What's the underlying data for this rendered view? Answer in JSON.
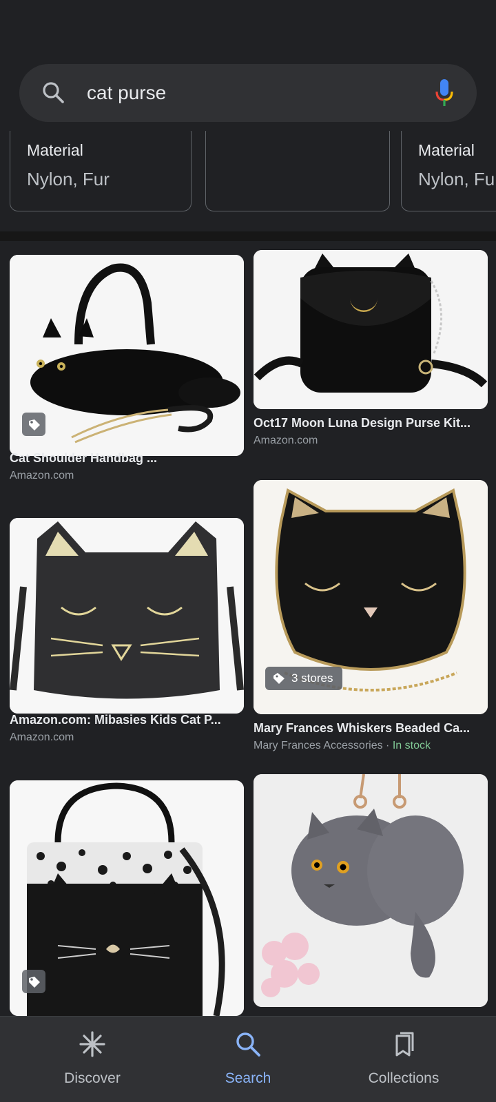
{
  "search": {
    "query": "cat purse",
    "search_icon": "search-icon",
    "mic_icon": "mic-icon"
  },
  "attribute_cards": [
    {
      "label": "Material",
      "value": "Nylon, Fur"
    },
    {
      "label": "",
      "value": ""
    },
    {
      "label": "Material",
      "value": "Nylon, Fu"
    }
  ],
  "results": [
    {
      "title": "Cat Shoulder Handbag ...",
      "source": "Amazon.com",
      "badge": "tag-icon"
    },
    {
      "title": "Oct17 Moon Luna Design Purse Kit...",
      "source": "Amazon.com"
    },
    {
      "title": "Amazon.com: Mibasies Kids Cat P...",
      "source": "Amazon.com"
    },
    {
      "title": "Mary Frances Whiskers Beaded Ca...",
      "source": "Mary Frances Accessories",
      "separator": " · ",
      "stock": "In stock",
      "stores_badge": "3 stores"
    },
    {
      "title": "",
      "source": "",
      "badge": "tag-icon"
    },
    {
      "title": "",
      "source": ""
    }
  ],
  "bottom_nav": [
    {
      "label": "Discover",
      "icon": "asterisk-icon",
      "active": false
    },
    {
      "label": "Search",
      "icon": "search-icon",
      "active": true
    },
    {
      "label": "Collections",
      "icon": "collections-icon",
      "active": false
    }
  ],
  "colors": {
    "background": "#202124",
    "accent": "#8ab4f8",
    "in_stock": "#81c995"
  }
}
